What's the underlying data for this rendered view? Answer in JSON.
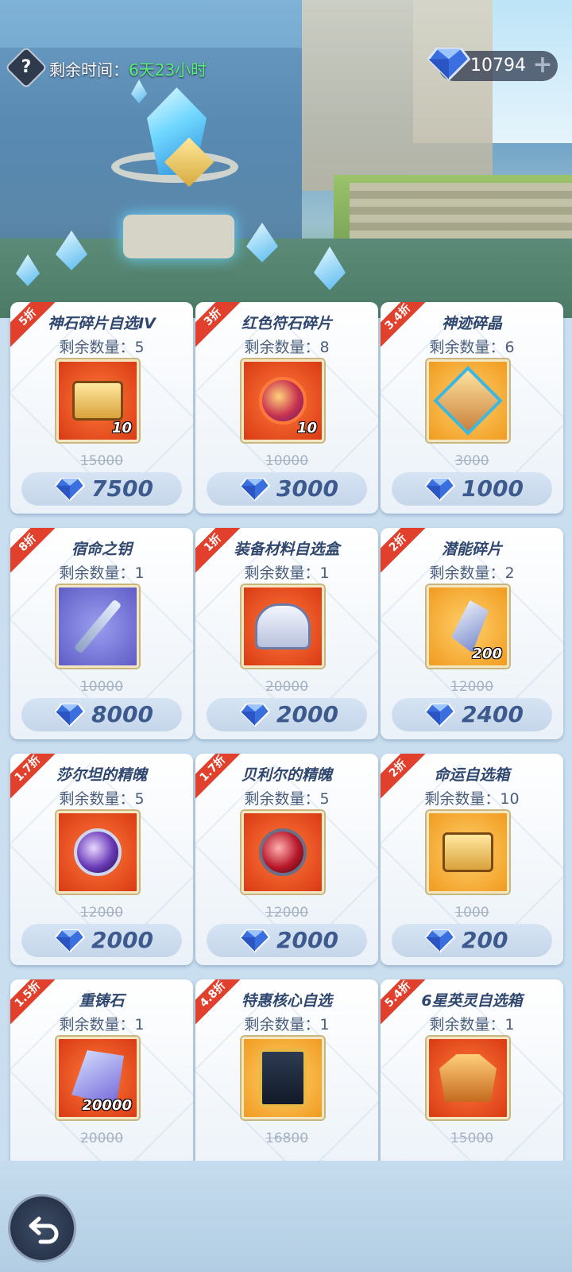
{
  "header": {
    "help_label": "?",
    "timer_label": "剩余时间：",
    "timer_value": "6天23小时",
    "gem_balance": "10794",
    "add_label": "+"
  },
  "colors": {
    "discount_badge": "#e0402c",
    "price_text": "#3d5a8e",
    "timer_value": "#56f07a",
    "gem": "#3b6fe0"
  },
  "items": [
    {
      "discount": "5折",
      "name": "神石碎片自选IV",
      "stock": "剩余数量：5",
      "qty": "10",
      "old_price": "15000",
      "price": "7500",
      "icon": "gold-chest-icon"
    },
    {
      "discount": "3折",
      "name": "红色符石碎片",
      "stock": "剩余数量：8",
      "qty": "10",
      "old_price": "10000",
      "price": "3000",
      "icon": "red-rune-icon"
    },
    {
      "discount": "3.4折",
      "name": "神迹碎晶",
      "stock": "剩余数量：6",
      "qty": "",
      "old_price": "3000",
      "price": "1000",
      "icon": "divine-crystal-icon"
    },
    {
      "discount": "8折",
      "name": "宿命之钥",
      "stock": "剩余数量：1",
      "qty": "",
      "old_price": "10000",
      "price": "8000",
      "icon": "destiny-key-icon"
    },
    {
      "discount": "1折",
      "name": "装备材料自选盒",
      "stock": "剩余数量：1",
      "qty": "",
      "old_price": "20000",
      "price": "2000",
      "icon": "armor-box-icon"
    },
    {
      "discount": "2折",
      "name": "潜能碎片",
      "stock": "剩余数量：2",
      "qty": "200",
      "old_price": "12000",
      "price": "2400",
      "icon": "potential-shard-icon"
    },
    {
      "discount": "1.7折",
      "name": "莎尔坦的精魄",
      "stock": "剩余数量：5",
      "qty": "",
      "old_price": "12000",
      "price": "2000",
      "icon": "purple-orb-icon"
    },
    {
      "discount": "1.7折",
      "name": "贝利尔的精魄",
      "stock": "剩余数量：5",
      "qty": "",
      "old_price": "12000",
      "price": "2000",
      "icon": "red-orb-icon"
    },
    {
      "discount": "2折",
      "name": "命运自选箱",
      "stock": "剩余数量：10",
      "qty": "",
      "old_price": "1000",
      "price": "200",
      "icon": "destiny-chest-icon"
    },
    {
      "discount": "1.5折",
      "name": "重铸石",
      "stock": "剩余数量：1",
      "qty": "20000",
      "old_price": "20000",
      "price": "",
      "icon": "recast-stone-icon"
    },
    {
      "discount": "4.8折",
      "name": "特惠核心自选",
      "stock": "剩余数量：1",
      "qty": "",
      "old_price": "16800",
      "price": "",
      "icon": "core-card-icon"
    },
    {
      "discount": "5.4折",
      "name": "6星英灵自选箱",
      "stock": "剩余数量：1",
      "qty": "",
      "old_price": "15000",
      "price": "",
      "icon": "hero-helm-icon"
    }
  ]
}
